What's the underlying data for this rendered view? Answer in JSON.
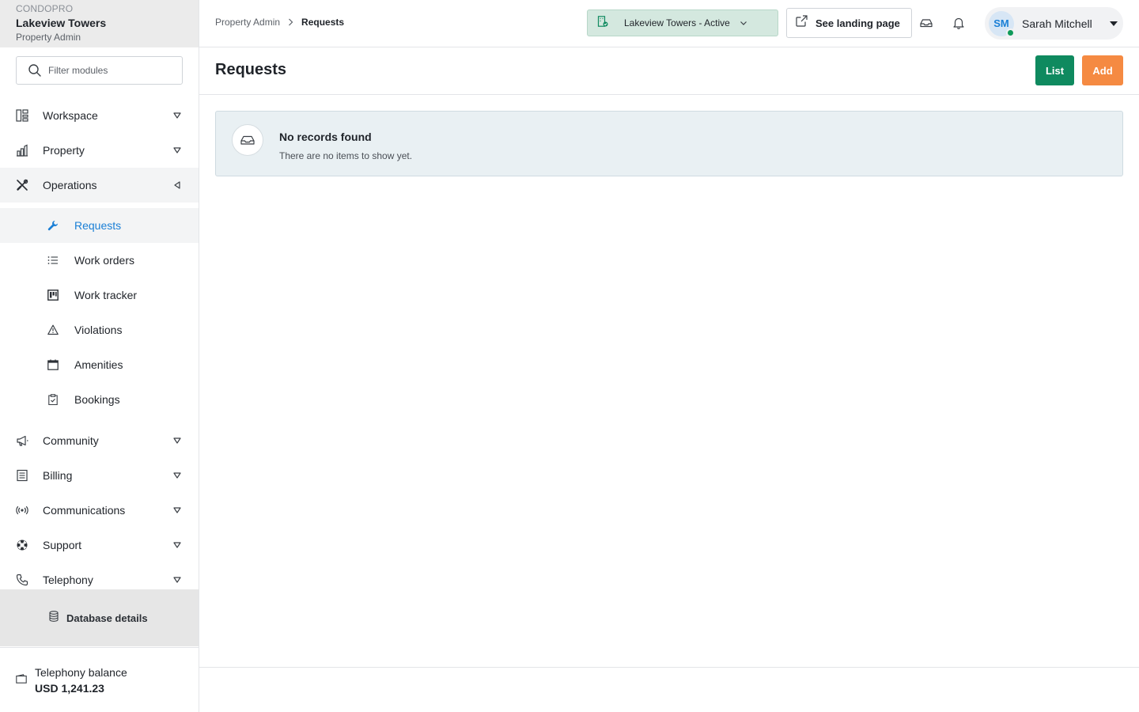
{
  "brand": {
    "tag": "CONDOPRO",
    "property_name": "Lakeview Towers",
    "role": "Property Admin"
  },
  "filter": {
    "placeholder": "Filter modules",
    "value": ""
  },
  "nav": {
    "items": [
      {
        "label": "Workspace",
        "icon": "layout-grid-icon",
        "state": "collapsed"
      },
      {
        "label": "Property",
        "icon": "building-chart-icon",
        "state": "collapsed"
      },
      {
        "label": "Operations",
        "icon": "tools-icon",
        "state": "expanded"
      },
      {
        "label": "Community",
        "icon": "megaphone-icon",
        "state": "collapsed"
      },
      {
        "label": "Billing",
        "icon": "receipt-icon",
        "state": "collapsed"
      },
      {
        "label": "Communications",
        "icon": "broadcast-icon",
        "state": "collapsed"
      },
      {
        "label": "Support",
        "icon": "lifebuoy-icon",
        "state": "collapsed"
      },
      {
        "label": "Telephony",
        "icon": "phone-icon",
        "state": "collapsed"
      }
    ],
    "operations_sub": [
      {
        "label": "Requests",
        "icon": "wrench-icon",
        "active": true
      },
      {
        "label": "Work orders",
        "icon": "list-icon",
        "active": false
      },
      {
        "label": "Work tracker",
        "icon": "kanban-icon",
        "active": false
      },
      {
        "label": "Violations",
        "icon": "warning-icon",
        "active": false
      },
      {
        "label": "Amenities",
        "icon": "calendar-icon",
        "active": false
      },
      {
        "label": "Bookings",
        "icon": "clipboard-icon",
        "active": false
      }
    ]
  },
  "database": {
    "label": "Database details"
  },
  "balance": {
    "label": "Telephony balance",
    "value": "USD 1,241.23"
  },
  "breadcrumb": {
    "parent": "Property Admin",
    "current": "Requests"
  },
  "property_select": {
    "value": "Lakeview Towers - Active"
  },
  "landing": {
    "label": "See landing page"
  },
  "user": {
    "initials": "SM",
    "name": "Sarah Mitchell",
    "status_color": "#0f9a5a"
  },
  "page": {
    "title": "Requests",
    "list_label": "List",
    "add_label": "Add"
  },
  "empty_state": {
    "title": "No records found",
    "message": "There are no items to show yet."
  },
  "colors": {
    "accent_blue": "#1a7fd6",
    "list_green": "#0f8a5f",
    "add_orange": "#f58a42",
    "property_bg": "#d4e8df"
  }
}
